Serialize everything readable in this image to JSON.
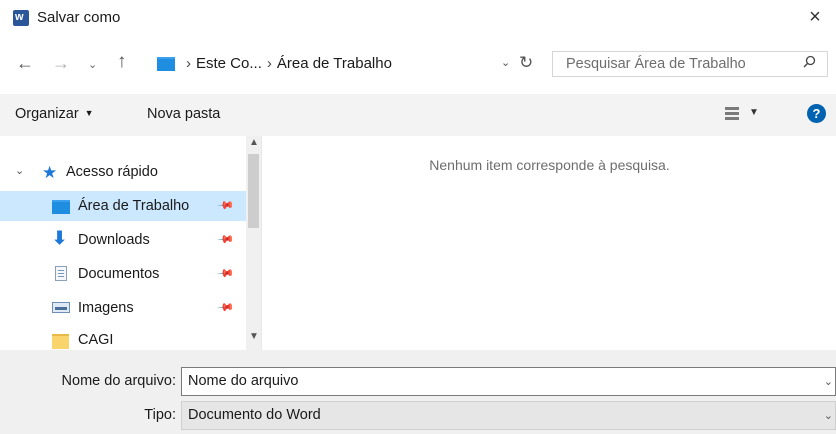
{
  "window": {
    "app_icon_letter": "w",
    "title": "Salvar como",
    "close_symbol": "×"
  },
  "address_bar": {
    "path": [
      "Este Co...",
      "Área de Trabalho"
    ],
    "separator": "›"
  },
  "search": {
    "placeholder": "Pesquisar Área de Trabalho"
  },
  "toolbar": {
    "organize_label": "Organizar",
    "new_folder_label": "Nova pasta",
    "help_label": "?"
  },
  "nav_pane": {
    "quick_access_label": "Acesso rápido",
    "items": [
      {
        "label": "Área de Trabalho",
        "icon": "desktop-icon",
        "pinned": true,
        "selected": true
      },
      {
        "label": "Downloads",
        "icon": "downloads-icon",
        "pinned": true,
        "selected": false
      },
      {
        "label": "Documentos",
        "icon": "documents-icon",
        "pinned": true,
        "selected": false
      },
      {
        "label": "Imagens",
        "icon": "pictures-icon",
        "pinned": true,
        "selected": false
      },
      {
        "label": "CAGI",
        "icon": "folder-icon",
        "pinned": false,
        "selected": false
      }
    ]
  },
  "content": {
    "empty_message": "Nenhum item corresponde à pesquisa."
  },
  "footer": {
    "file_name_label": "Nome do arquivo:",
    "file_name_value": "Nome do arquivo",
    "type_label": "Tipo:",
    "type_value": "Documento do Word"
  },
  "colors": {
    "selection": "#cce8ff",
    "accent": "#0063b1",
    "toolbar_bg": "#f3f3f3",
    "footer_bg": "#f0f0f0"
  }
}
